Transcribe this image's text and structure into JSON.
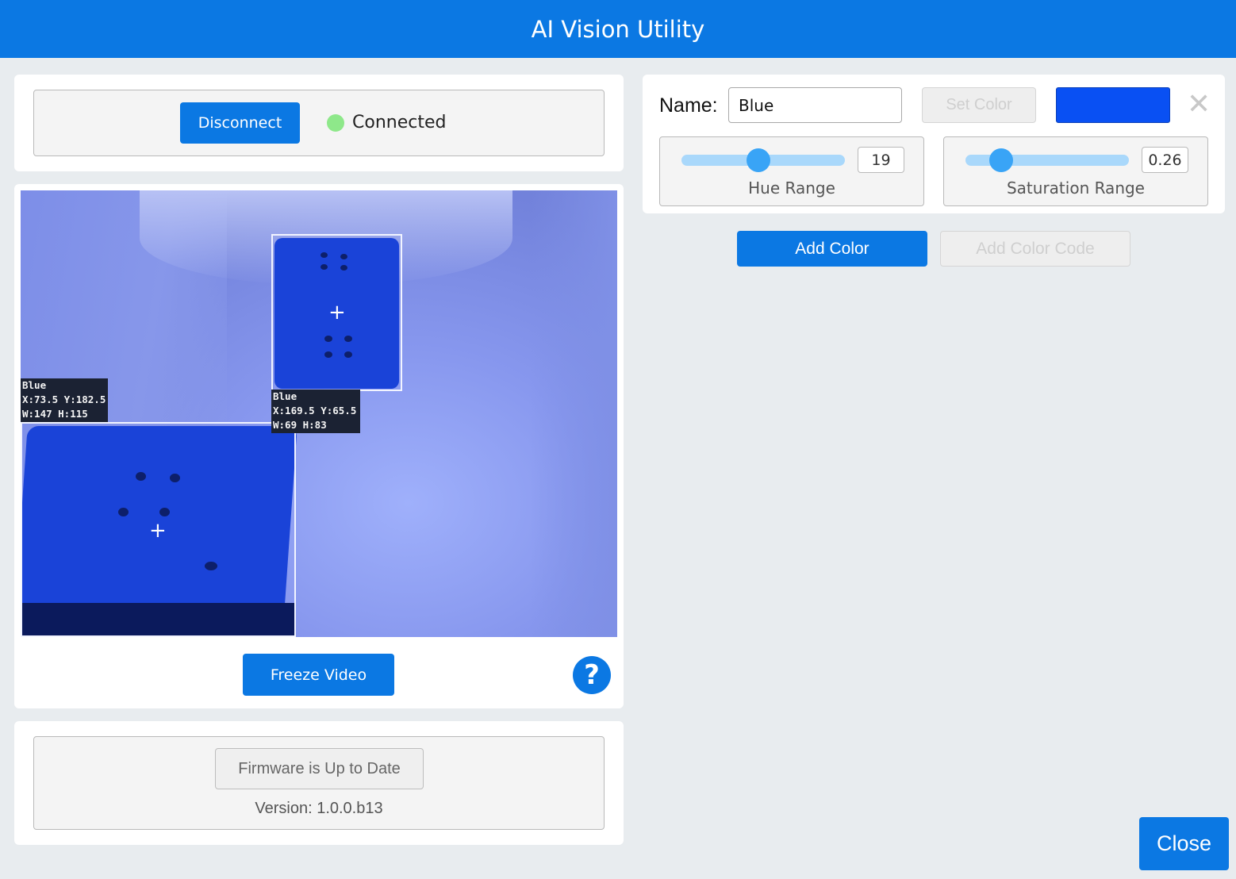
{
  "window": {
    "title": "AI Vision Utility"
  },
  "connection": {
    "disconnect_label": "Disconnect",
    "status_text": "Connected",
    "status_color": "#8ee88a"
  },
  "camera": {
    "detections": [
      {
        "name": "Blue",
        "coords": "X:73.5 Y:182.5",
        "size": "W:147 H:115"
      },
      {
        "name": "Blue",
        "coords": "X:169.5 Y:65.5",
        "size": "W:69 H:83"
      }
    ],
    "freeze_label": "Freeze Video",
    "help_glyph": "?"
  },
  "firmware": {
    "status_label": "Firmware is Up to Date",
    "version_text": "Version: 1.0.0.b13"
  },
  "color_editor": {
    "name_label": "Name:",
    "name_value": "Blue",
    "set_color_label": "Set Color",
    "swatch_color": "#0950f3",
    "close_glyph": "✕",
    "hue": {
      "label": "Hue Range",
      "value": "19",
      "fraction": 0.47
    },
    "saturation": {
      "label": "Saturation Range",
      "value": "0.26",
      "fraction": 0.22
    }
  },
  "actions": {
    "add_color_label": "Add Color",
    "add_color_code_label": "Add Color Code",
    "close_label": "Close"
  },
  "colors": {
    "accent": "#0b78e3",
    "background": "#e8ecef"
  }
}
